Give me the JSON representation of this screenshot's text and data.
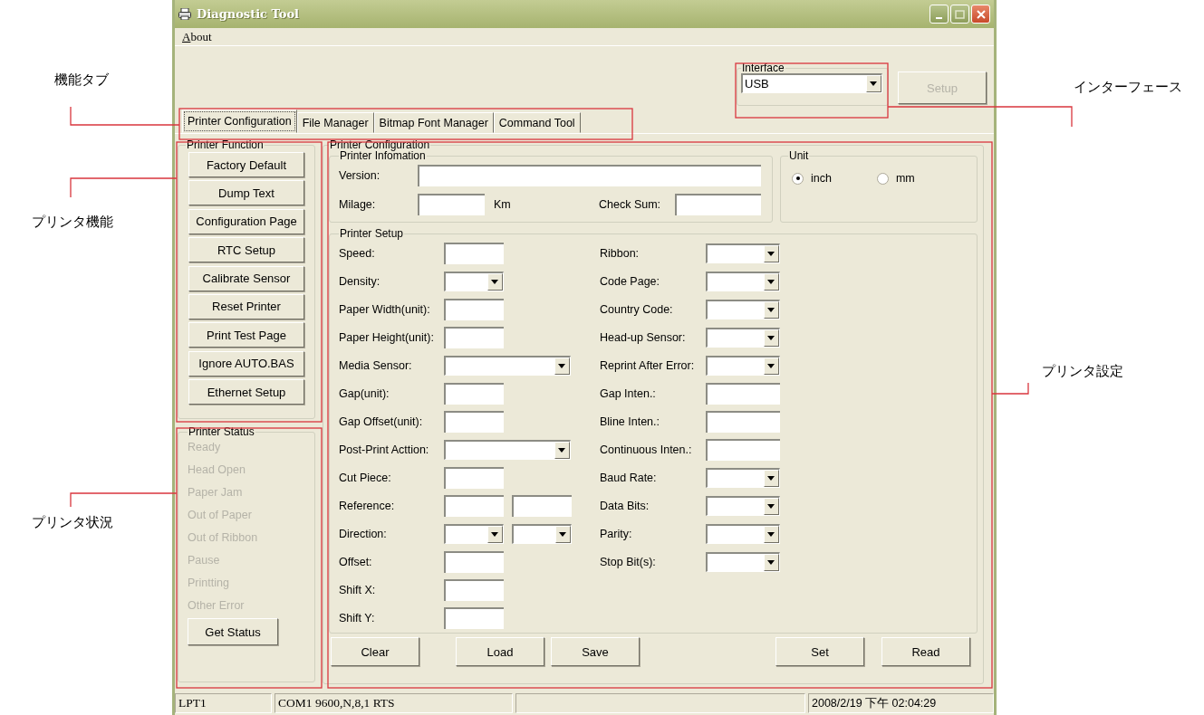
{
  "window": {
    "title": "Diagnostic Tool"
  },
  "menu": [
    {
      "label": "About"
    }
  ],
  "interface": {
    "title": "Interface",
    "value": "USB"
  },
  "setup_button": {
    "label": "Setup",
    "disabled": true
  },
  "tabs": [
    {
      "label": "Printer Configuration",
      "selected": true
    },
    {
      "label": "File Manager",
      "selected": false
    },
    {
      "label": "Bitmap Font Manager",
      "selected": false
    },
    {
      "label": "Command Tool",
      "selected": false
    }
  ],
  "printer_function": {
    "title": "Printer Function",
    "buttons": [
      "Factory Default",
      "Dump Text",
      "Configuration Page",
      "RTC Setup",
      "Calibrate Sensor",
      "Reset Printer",
      "Print Test Page",
      "Ignore AUTO.BAS",
      "Ethernet Setup"
    ]
  },
  "printer_status": {
    "title": "Printer Status",
    "items": [
      {
        "label": "Ready",
        "disabled": true
      },
      {
        "label": "Head Open",
        "disabled": true
      },
      {
        "label": "Paper Jam",
        "disabled": true
      },
      {
        "label": "Out of Paper",
        "disabled": true
      },
      {
        "label": "Out of Ribbon",
        "disabled": true
      },
      {
        "label": "Pause",
        "disabled": true
      },
      {
        "label": "Printting",
        "disabled": true
      },
      {
        "label": "Other Error",
        "disabled": true
      }
    ],
    "button": "Get Status"
  },
  "printer_configuration": {
    "title": "Printer Configuration",
    "printer_information": {
      "title": "Printer Infomation",
      "version_label": "Version:",
      "milage_label": "Milage:",
      "milage_unit": "Km",
      "check_sum_label": "Check Sum:"
    },
    "unit": {
      "title": "Unit",
      "options": [
        {
          "label": "inch",
          "selected": true
        },
        {
          "label": "mm",
          "selected": false
        }
      ]
    },
    "printer_setup": {
      "title": "Printer Setup",
      "left": [
        {
          "label": "Speed:",
          "kind": "text"
        },
        {
          "label": "Density:",
          "kind": "combo"
        },
        {
          "label": "Paper Width(unit):",
          "kind": "text"
        },
        {
          "label": "Paper Height(unit):",
          "kind": "text"
        },
        {
          "label": "Media Sensor:",
          "kind": "wide_combo"
        },
        {
          "label": "Gap(unit):",
          "kind": "text"
        },
        {
          "label": "Gap Offset(unit):",
          "kind": "text"
        },
        {
          "label": "Post-Print Acttion:",
          "kind": "wide_combo"
        },
        {
          "label": "Cut Piece:",
          "kind": "text"
        },
        {
          "label": "Reference:",
          "kind": "text_pair"
        },
        {
          "label": "Direction:",
          "kind": "combo_pair"
        },
        {
          "label": "Offset:",
          "kind": "text"
        },
        {
          "label": "Shift X:",
          "kind": "text"
        },
        {
          "label": "Shift Y:",
          "kind": "text"
        }
      ],
      "right": [
        {
          "label": "Ribbon:",
          "kind": "combo"
        },
        {
          "label": "Code Page:",
          "kind": "combo"
        },
        {
          "label": "Country Code:",
          "kind": "combo"
        },
        {
          "label": "Head-up Sensor:",
          "kind": "combo"
        },
        {
          "label": "Reprint After Error:",
          "kind": "combo"
        },
        {
          "label": "Gap Inten.:",
          "kind": "text"
        },
        {
          "label": "Bline Inten.:",
          "kind": "text"
        },
        {
          "label": "Continuous Inten.:",
          "kind": "text"
        },
        {
          "label": "Baud Rate:",
          "kind": "combo"
        },
        {
          "label": "Data Bits:",
          "kind": "combo"
        },
        {
          "label": "Parity:",
          "kind": "combo"
        },
        {
          "label": "Stop Bit(s):",
          "kind": "combo"
        }
      ]
    },
    "buttons_left": [
      "Clear",
      "Load",
      "Save"
    ],
    "buttons_right": [
      "Set",
      "Read"
    ]
  },
  "status_bar": {
    "port": "LPT1",
    "serial": "COM1 9600,N,8,1 RTS",
    "datetime": "2008/2/19 下午 02:04:29"
  },
  "annotations": [
    {
      "label": "機能タブ"
    },
    {
      "label": "プリンタ機能"
    },
    {
      "label": "プリンタ状況"
    },
    {
      "label": "インターフェース"
    },
    {
      "label": "プリンタ設定"
    }
  ]
}
